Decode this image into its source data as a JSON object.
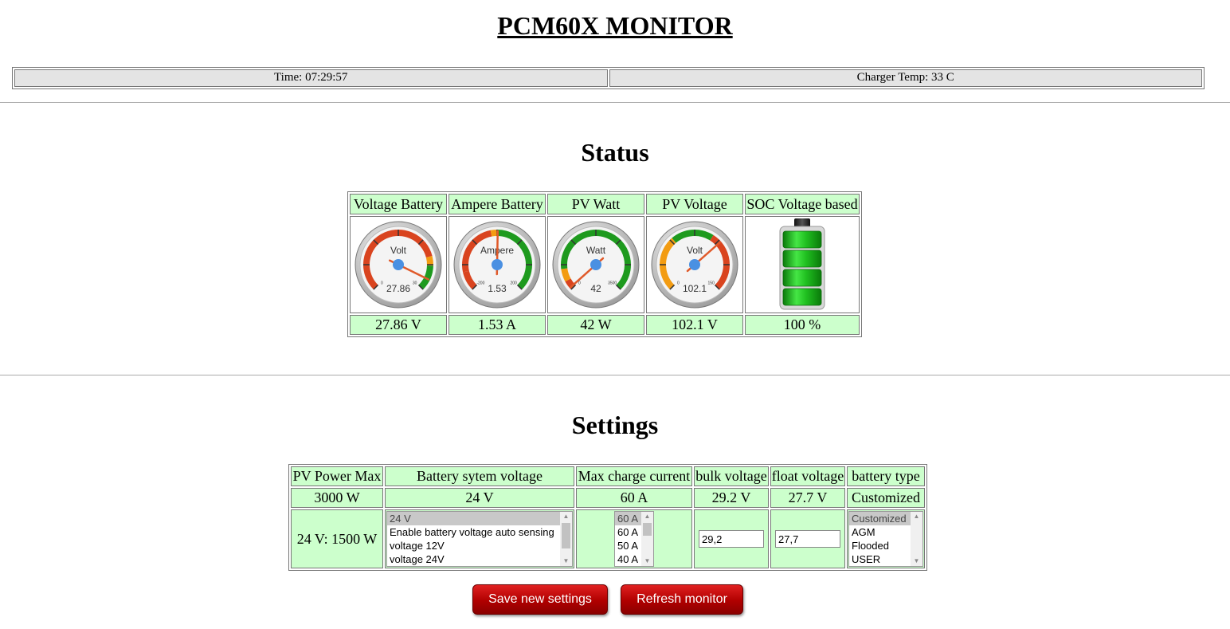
{
  "app_title": "PCM60X MONITOR",
  "topbar": {
    "time": "Time: 07:29:57",
    "charger_temp": "Charger Temp: 33 C"
  },
  "status": {
    "title": "Status",
    "headers": [
      "Voltage Battery",
      "Ampere Battery",
      "PV Watt",
      "PV Voltage",
      "SOC Voltage based"
    ],
    "gauges": [
      {
        "label": "Volt",
        "value": "27.86",
        "min": "0",
        "max": "30",
        "level": 0.93
      },
      {
        "label": "Ampere",
        "value": "1.53",
        "min": "-200",
        "max": "200",
        "level": 0.504
      },
      {
        "label": "Watt",
        "value": "42",
        "min": "0",
        "max": "3500",
        "level": 0.012
      },
      {
        "label": "Volt",
        "value": "102.1",
        "min": "0",
        "max": "150",
        "level": 0.68
      }
    ],
    "soc_level": 1.0,
    "values": [
      "27.86 V",
      "1.53 A",
      "42 W",
      "102.1 V",
      "100 %"
    ]
  },
  "settings": {
    "title": "Settings",
    "headers": [
      "PV Power Max",
      "Battery sytem voltage",
      "Max charge current",
      "bulk voltage",
      "float voltage",
      "battery type"
    ],
    "current": [
      "3000 W",
      "24 V",
      "60 A",
      "29.2 V",
      "27.7 V",
      "Customized"
    ],
    "pv_power_note": "24 V: 1500 W",
    "battery_voltage_options": [
      "24 V",
      "Enable battery voltage auto sensing",
      "voltage 12V",
      "voltage 24V"
    ],
    "charge_current_options": [
      "60 A",
      "60 A",
      "50 A",
      "40 A"
    ],
    "bulk_input": "29,2",
    "float_input": "27,7",
    "battery_type_options": [
      "Customized",
      "AGM",
      "Flooded",
      "USER"
    ]
  },
  "buttons": {
    "save": "Save new settings",
    "refresh": "Refresh monitor"
  },
  "colors": {
    "cell_bg": "#ccffcc",
    "gauge_red": "#d9441f",
    "gauge_green": "#1e9a1e",
    "gauge_orange": "#f39c12",
    "needle_hub": "#4a90e2",
    "button_red": "#c00000"
  }
}
